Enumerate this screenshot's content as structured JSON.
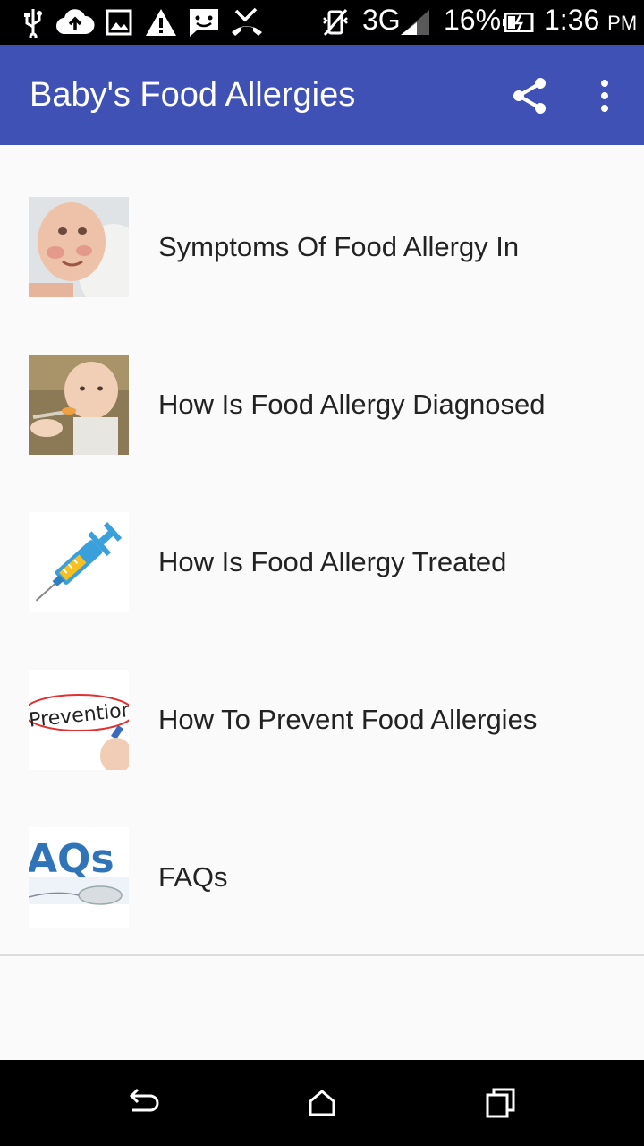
{
  "status_bar": {
    "network": "3G",
    "battery": "16%",
    "time": "1:36",
    "time_suffix": "PM",
    "icons": [
      "usb-icon",
      "cloud-upload-icon",
      "image-icon",
      "warning-icon",
      "message-icon",
      "missed-call-icon",
      "vibrate-off-icon",
      "signal-icon",
      "battery-icon"
    ]
  },
  "app_bar": {
    "title": "Baby's Food Allergies",
    "actions": [
      "share-icon",
      "more-vert-icon"
    ],
    "color": "#3f51b5"
  },
  "list": {
    "items": [
      {
        "label": "Symptoms Of Food Allergy In",
        "thumb": "baby-face-image"
      },
      {
        "label": "How Is Food Allergy Diagnosed",
        "thumb": "baby-eating-image"
      },
      {
        "label": "How Is Food Allergy Treated",
        "thumb": "syringe-image"
      },
      {
        "label": "How To Prevent Food Allergies",
        "thumb": "prevention-image",
        "thumb_text": "Prevention"
      },
      {
        "label": "FAQs",
        "thumb": "faqs-image",
        "thumb_text": "AQs"
      }
    ]
  },
  "nav_bar": {
    "buttons": [
      "back-icon",
      "home-icon",
      "recents-icon"
    ]
  }
}
